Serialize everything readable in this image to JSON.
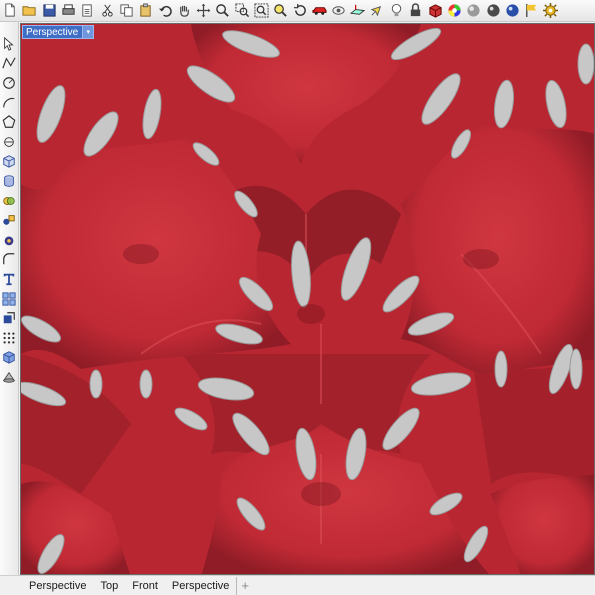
{
  "toolbar": {
    "icons": [
      "new-file-icon",
      "open-folder-icon",
      "save-icon",
      "print-icon",
      "import-icon",
      "cut-icon",
      "copy-icon",
      "paste-icon",
      "undo-icon",
      "pan-hand-icon",
      "move-icon",
      "zoom-icon",
      "zoom-window-icon",
      "zoom-extents-icon",
      "zoom-selected-icon",
      "rotate-view-icon",
      "car-icon",
      "named-view-icon",
      "construction-plane-icon",
      "select-icon",
      "lightbulb-icon",
      "lock-icon",
      "rendered-display-icon",
      "color-wheel-icon",
      "shaded-sphere-icon",
      "material-sphere-icon",
      "render-sphere-icon",
      "flag-icon",
      "gear-icon"
    ]
  },
  "lefttools": {
    "icons": [
      "select-arrow-icon",
      "polyline-icon",
      "circle-icon",
      "arc-icon",
      "polygon-icon",
      "curve-tools-icon",
      "box-icon",
      "cylinder-icon",
      "solid-tools-icon",
      "shapes-icon",
      "boolean-icon",
      "curve-fillet-icon",
      "text-icon",
      "array-icon",
      "transform-icon",
      "grid-points-icon",
      "cube-icon",
      "cylinder-tools-icon"
    ]
  },
  "viewport": {
    "title": "Perspective",
    "dropdown": "▾",
    "colors": {
      "surface": "#c8303a",
      "surface_dark": "#8a1f28",
      "hole": "#c7c7c7"
    }
  },
  "tabs": {
    "items": [
      "Perspective",
      "Top",
      "Front",
      "Perspective"
    ],
    "add": "+"
  }
}
